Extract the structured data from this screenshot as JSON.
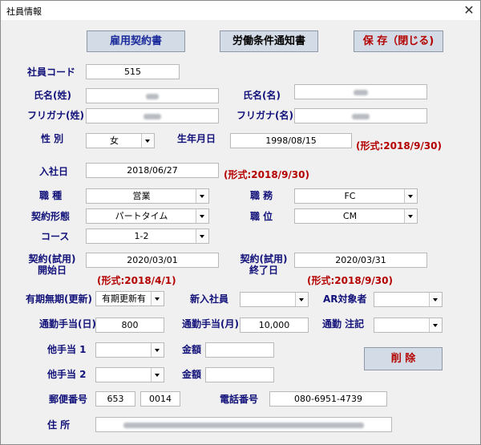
{
  "window": {
    "title": "社員情報",
    "close_label": "✕"
  },
  "buttons": {
    "contract": {
      "label": "雇用契約書",
      "color": "#1a2a9a"
    },
    "notice": {
      "label": "労働条件通知書",
      "color": "#000000"
    },
    "save": {
      "label": "保 存（閉じる)",
      "color": "#b40000"
    },
    "delete": {
      "label": "削 除",
      "color": "#b40000"
    }
  },
  "labels": {
    "employee_code": "社員コード",
    "last_name": "氏名(姓)",
    "first_name": "氏名(名)",
    "last_kana": "フリガナ(姓)",
    "first_kana": "フリガナ(名)",
    "gender": "性 別",
    "birthdate": "生年月日",
    "hire_date": "入社日",
    "job_type": "職 種",
    "duty": "職 務",
    "contract_type": "契約形態",
    "position": "職 位",
    "course": "コース",
    "contract_start_1": "契約(試用)",
    "contract_start_2": "開始日",
    "contract_end_1": "契約(試用)",
    "contract_end_2": "終了日",
    "term": "有期無期(更新)",
    "new_employee": "新入社員",
    "ar_target": "AR対象者",
    "commute_day": "通勤手当(日)",
    "commute_month": "通勤手当(月)",
    "commute_note": "通勤 注記",
    "other_allowance_1": "他手当 1",
    "amount_1": "金額",
    "other_allowance_2": "他手当 2",
    "amount_2": "金額",
    "postal_code": "郵便番号",
    "phone": "電話番号",
    "address": "住 所"
  },
  "formats": {
    "birthdate": "(形式:2018/9/30)",
    "hire_date": "(形式:2018/9/30)",
    "contract_start": "(形式:2018/4/1)",
    "contract_end": "(形式:2018/9/30)"
  },
  "fields": {
    "employee_code": "515",
    "gender": "女",
    "birthdate": "1998/08/15",
    "hire_date": "2018/06/27",
    "job_type": "営業",
    "duty": "FC",
    "contract_type": "パートタイム",
    "position": "CM",
    "course": "1-2",
    "contract_start": "2020/03/01",
    "contract_end": "2020/03/31",
    "term": "有期更新有",
    "new_employee": "",
    "ar_target": "",
    "commute_day": "800",
    "commute_month": "10,000",
    "commute_note": "",
    "other_allowance_1": "",
    "amount_1": "",
    "other_allowance_2": "",
    "amount_2": "",
    "postal_1": "653",
    "postal_2": "0014",
    "phone": "080-6951-4739"
  },
  "icons": {
    "close": "close-icon",
    "dropdown": "chevron-down-icon"
  }
}
